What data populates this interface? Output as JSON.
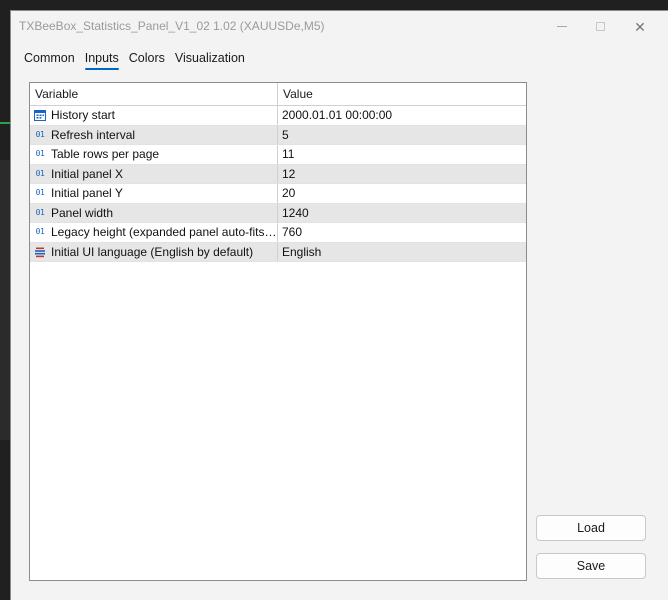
{
  "window": {
    "title": "TXBeeBox_Statistics_Panel_V1_02 1.02 (XAUUSDe,M5)",
    "minimize_glyph": "minimize-icon",
    "maximize_glyph": "maximize-icon",
    "close_glyph": "✕"
  },
  "tabs": [
    {
      "label": "Common",
      "active": false
    },
    {
      "label": "Inputs",
      "active": true
    },
    {
      "label": "Colors",
      "active": false
    },
    {
      "label": "Visualization",
      "active": false
    }
  ],
  "grid": {
    "headers": {
      "variable": "Variable",
      "value": "Value"
    },
    "rows": [
      {
        "icon": "calendar-icon",
        "icon_text": "",
        "variable": "History start",
        "value": "2000.01.01 00:00:00"
      },
      {
        "icon": "integer-icon",
        "icon_text": "01",
        "variable": "Refresh interval",
        "value": "5"
      },
      {
        "icon": "integer-icon",
        "icon_text": "01",
        "variable": "Table rows per page",
        "value": "11"
      },
      {
        "icon": "integer-icon",
        "icon_text": "01",
        "variable": "Initial panel X",
        "value": "12"
      },
      {
        "icon": "integer-icon",
        "icon_text": "01",
        "variable": "Initial panel Y",
        "value": "20"
      },
      {
        "icon": "integer-icon",
        "icon_text": "01",
        "variable": "Panel width",
        "value": "1240"
      },
      {
        "icon": "integer-icon",
        "icon_text": "01",
        "variable": "Legacy height (expanded panel auto-fits…",
        "value": "760"
      },
      {
        "icon": "enum-list-icon",
        "icon_text": "",
        "variable": "Initial UI language (English by default)",
        "value": "English"
      }
    ]
  },
  "buttons": {
    "load_label": "Load",
    "save_label": "Save"
  },
  "colors": {
    "accent": "#0067c0",
    "integer_icon": "#1b63c6",
    "alt_row": "#e6e6e6"
  }
}
